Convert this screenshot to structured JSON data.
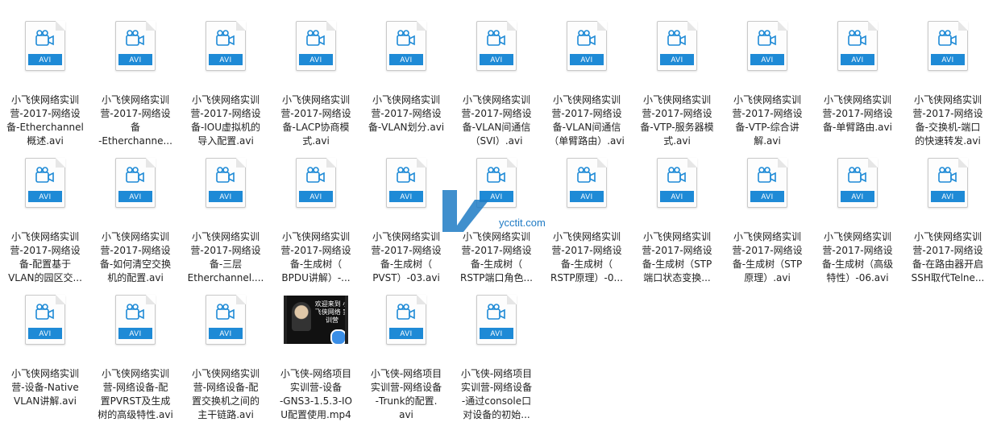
{
  "colors": {
    "accent": "#1e8ad6",
    "watermark": "#1f7bc4"
  },
  "watermark": {
    "text": "ycctit.com"
  },
  "files": [
    {
      "name": "小飞侠网络实训\n营-2017-网络设\n备-Etherchannel\n概述.avi",
      "type": "avi",
      "icon": "video-file-icon"
    },
    {
      "name": "小飞侠网络实训\n营-2017-网络设\n备\n-Etherchanne...",
      "type": "avi",
      "icon": "video-file-icon"
    },
    {
      "name": "小飞侠网络实训\n营-2017-网络设\n备-IOU虚拟机的\n导入配置.avi",
      "type": "avi",
      "icon": "video-file-icon"
    },
    {
      "name": "小飞侠网络实训\n营-2017-网络设\n备-LACP协商模\n式.avi",
      "type": "avi",
      "icon": "video-file-icon"
    },
    {
      "name": "小飞侠网络实训\n营-2017-网络设\n备-VLAN划分.avi",
      "type": "avi",
      "icon": "video-file-icon"
    },
    {
      "name": "小飞侠网络实训\n营-2017-网络设\n备-VLAN间通信\n（SVI）.avi",
      "type": "avi",
      "icon": "video-file-icon"
    },
    {
      "name": "小飞侠网络实训\n营-2017-网络设\n备-VLAN间通信\n（单臂路由）.avi",
      "type": "avi",
      "icon": "video-file-icon"
    },
    {
      "name": "小飞侠网络实训\n营-2017-网络设\n备-VTP-服务器模\n式.avi",
      "type": "avi",
      "icon": "video-file-icon"
    },
    {
      "name": "小飞侠网络实训\n营-2017-网络设\n备-VTP-综合讲\n解.avi",
      "type": "avi",
      "icon": "video-file-icon"
    },
    {
      "name": "小飞侠网络实训\n营-2017-网络设\n备-单臂路由.avi",
      "type": "avi",
      "icon": "video-file-icon"
    },
    {
      "name": "小飞侠网络实训\n营-2017-网络设\n备-交换机-端口\n的快速转发.avi",
      "type": "avi",
      "icon": "video-file-icon"
    },
    {
      "name": "小飞侠网络实训\n营-2017-网络设\n备-配置基于\nVLAN的园区交...",
      "type": "avi",
      "icon": "video-file-icon"
    },
    {
      "name": "小飞侠网络实训\n营-2017-网络设\n备-如何清空交换\n机的配置.avi",
      "type": "avi",
      "icon": "video-file-icon"
    },
    {
      "name": "小飞侠网络实训\n营-2017-网络设\n备-三层\nEtherchannel....",
      "type": "avi",
      "icon": "video-file-icon"
    },
    {
      "name": "小飞侠网络实训\n营-2017-网络设\n备-生成树（\nBPDU讲解）-...",
      "type": "avi",
      "icon": "video-file-icon"
    },
    {
      "name": "小飞侠网络实训\n营-2017-网络设\n备-生成树（\nPVST）-03.avi",
      "type": "avi",
      "icon": "video-file-icon"
    },
    {
      "name": "小飞侠网络实训\n营-2017-网络设\n备-生成树（\nRSTP端口角色...",
      "type": "avi",
      "icon": "video-file-icon"
    },
    {
      "name": "小飞侠网络实训\n营-2017-网络设\n备-生成树（\nRSTP原理）-0...",
      "type": "avi",
      "icon": "video-file-icon"
    },
    {
      "name": "小飞侠网络实训\n营-2017-网络设\n备-生成树（STP\n端口状态变换...",
      "type": "avi",
      "icon": "video-file-icon"
    },
    {
      "name": "小飞侠网络实训\n营-2017-网络设\n备-生成树（STP\n原理）.avi",
      "type": "avi",
      "icon": "video-file-icon"
    },
    {
      "name": "小飞侠网络实训\n营-2017-网络设\n备-生成树（高级\n特性）-06.avi",
      "type": "avi",
      "icon": "video-file-icon"
    },
    {
      "name": "小飞侠网络实训\n营-2017-网络设\n备-在路由器开启\nSSH取代Telne...",
      "type": "avi",
      "icon": "video-file-icon"
    },
    {
      "name": "小飞侠网络实训\n营-设备-Native\nVLAN讲解.avi",
      "type": "avi",
      "icon": "video-file-icon"
    },
    {
      "name": "小飞侠网络实训\n营-网络设备-配\n置PVRST及生成\n树的高级特性.avi",
      "type": "avi",
      "icon": "video-file-icon"
    },
    {
      "name": "小飞侠网络实训\n营-网络设备-配\n置交换机之间的\n主干链路.avi",
      "type": "avi",
      "icon": "video-file-icon"
    },
    {
      "name": "小飞侠-网络项目\n实训营-设备\n-GNS3-1.5.3-IO\nU配置使用.mp4",
      "type": "mp4",
      "icon": "video-thumbnail-icon",
      "thumb_caption": "欢迎来到\n小飞侠网络\n实训营"
    },
    {
      "name": "小飞侠-网络项目\n实训营-网络设备\n-Trunk的配置.\navi",
      "type": "avi",
      "icon": "video-file-icon"
    },
    {
      "name": "小飞侠-网络项目\n实训营-网络设备\n-通过console口\n对设备的初始...",
      "type": "avi",
      "icon": "video-file-icon"
    }
  ],
  "file_badge": "AVI"
}
